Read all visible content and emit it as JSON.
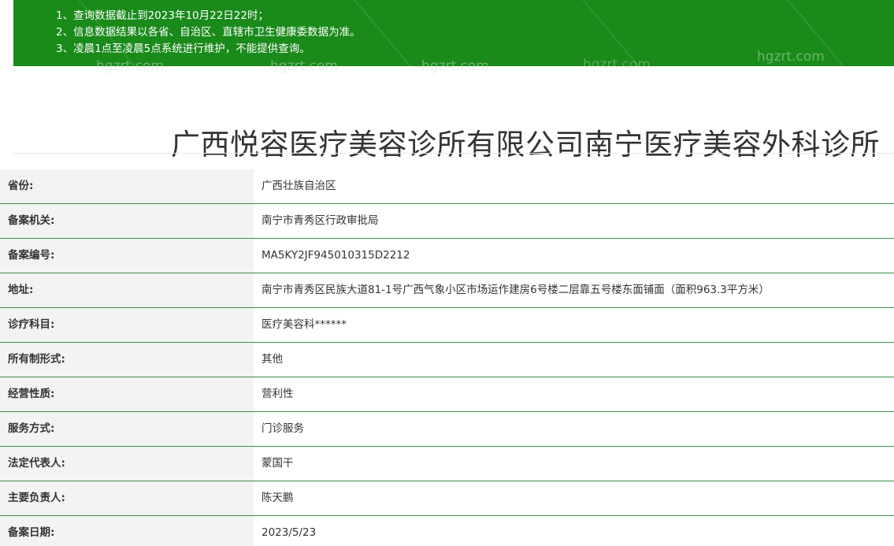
{
  "notice": {
    "line1": "1、查询数据截止到2023年10月22日22时；",
    "line2": "2、信息数据结果以各省、自治区、直辖市卫生健康委数据为准。",
    "line3": "3、凌晨1点至凌晨5点系统进行维护，不能提供查询。"
  },
  "watermark": "hgzrt.com",
  "title": "广西悦容医疗美容诊所有限公司南宁医疗美容外科诊所",
  "rows": [
    {
      "label": "省份:",
      "value": "广西壮族自治区"
    },
    {
      "label": "备案机关:",
      "value": "南宁市青秀区行政审批局"
    },
    {
      "label": "备案编号:",
      "value": "MA5KY2JF945010315D2212"
    },
    {
      "label": "地址:",
      "value": "南宁市青秀区民族大道81-1号广西气象小区市场运作建房6号楼二层靠五号楼东面铺面（面积963.3平方米）"
    },
    {
      "label": "诊疗科目:",
      "value": "医疗美容科******"
    },
    {
      "label": "所有制形式:",
      "value": "其他"
    },
    {
      "label": "经营性质:",
      "value": "营利性"
    },
    {
      "label": "服务方式:",
      "value": "门诊服务"
    },
    {
      "label": "法定代表人:",
      "value": "蒙国干"
    },
    {
      "label": "主要负责人:",
      "value": "陈天鹏"
    },
    {
      "label": "备案日期:",
      "value": "2023/5/23"
    }
  ]
}
